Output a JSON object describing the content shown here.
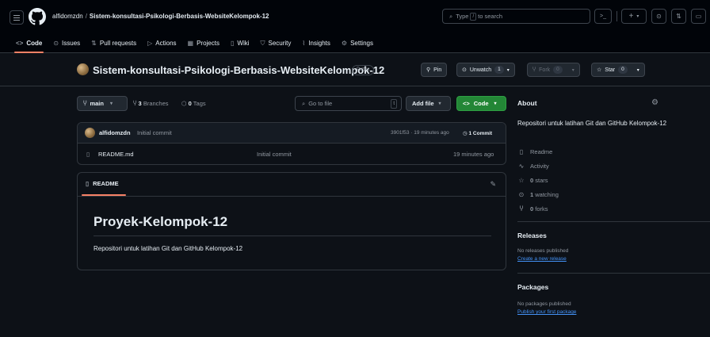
{
  "header": {
    "owner": "alfidomzdn",
    "separator": "/",
    "repo": "Sistem-konsultasi-Psikologi-Berbasis-WebsiteKelompok-12",
    "search_prefix": "Type",
    "search_key": "/",
    "search_suffix": "to search",
    "cmd_icon": ">_",
    "plus_icon": "+",
    "caret": "▾"
  },
  "tabs": [
    {
      "label": "Code",
      "icon": "<>"
    },
    {
      "label": "Issues",
      "icon": "⊙"
    },
    {
      "label": "Pull requests",
      "icon": "⇅"
    },
    {
      "label": "Actions",
      "icon": "▷"
    },
    {
      "label": "Projects",
      "icon": "▦"
    },
    {
      "label": "Wiki",
      "icon": "▯"
    },
    {
      "label": "Security",
      "icon": "⛉"
    },
    {
      "label": "Insights",
      "icon": "⌇"
    },
    {
      "label": "Settings",
      "icon": "⚙"
    }
  ],
  "repo_bar": {
    "title": "Sistem-konsultasi-Psikologi-Berbasis-WebsiteKelompok-12",
    "visibility": "Public",
    "pin": "Pin",
    "unwatch": "Unwatch",
    "watch_count": "1",
    "fork": "Fork",
    "fork_count": "0",
    "star": "Star",
    "star_count": "0"
  },
  "branch_bar": {
    "branch": "main",
    "branches_count": "3",
    "branches_label": "Branches",
    "tags_count": "0",
    "tags_label": "Tags",
    "goto_placeholder": "Go to file",
    "goto_key": "t",
    "add_file": "Add file",
    "code": "Code"
  },
  "commit": {
    "author": "alfidomzdn",
    "message": "Initial commit",
    "meta": "3901f53 · 19 minutes ago",
    "count": "1 Commit"
  },
  "files": [
    {
      "name": "README.md",
      "message": "Initial commit",
      "time": "19 minutes ago"
    }
  ],
  "readme": {
    "tab": "README",
    "heading": "Proyek-Kelompok-12",
    "body": "Repositori untuk latihan Git dan GitHub Kelompok-12"
  },
  "about": {
    "title": "About",
    "description": "Repositori untuk latihan Git dan GitHub Kelompok-12",
    "items": [
      {
        "icon": "▯",
        "label": "Readme"
      },
      {
        "icon": "∿",
        "label": "Activity"
      },
      {
        "icon": "☆",
        "count": "0",
        "label": "stars"
      },
      {
        "icon": "⊙",
        "count": "1",
        "label": "watching"
      },
      {
        "icon": "Ⴤ",
        "count": "0",
        "label": "forks"
      }
    ]
  },
  "releases": {
    "title": "Releases",
    "none": "No releases published",
    "link": "Create a new release"
  },
  "packages": {
    "title": "Packages",
    "none": "No packages published",
    "link": "Publish your first package"
  },
  "colors": {
    "bg": "#0d1117",
    "header_bg": "#010409",
    "accent_tab": "#f78166",
    "green_button": "#238636",
    "link": "#4493f8"
  }
}
